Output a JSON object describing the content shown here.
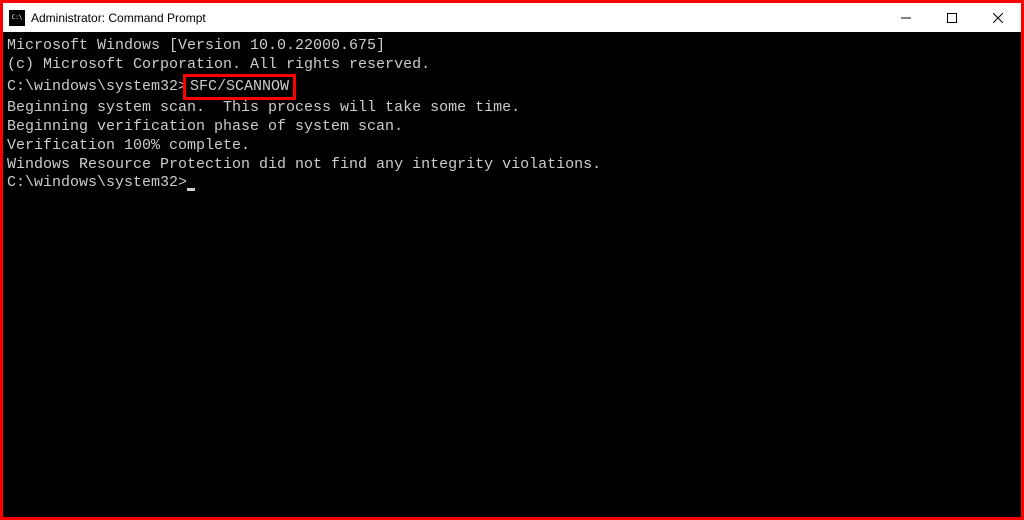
{
  "window": {
    "title": "Administrator: Command Prompt"
  },
  "colors": {
    "border": "#ff0000",
    "terminal_bg": "#000000",
    "terminal_fg": "#cccccc"
  },
  "terminal": {
    "lines": {
      "l0": "Microsoft Windows [Version 10.0.22000.675]",
      "l1": "(c) Microsoft Corporation. All rights reserved.",
      "l2": "",
      "prompt1_prefix": "C:\\windows\\system32>",
      "prompt1_cmd": "SFC/SCANNOW",
      "l4": "",
      "l5": "Beginning system scan.  This process will take some time.",
      "l6": "",
      "l7": "Beginning verification phase of system scan.",
      "l8": "Verification 100% complete.",
      "l9": "",
      "l10": "Windows Resource Protection did not find any integrity violations.",
      "l11": "",
      "prompt2": "C:\\windows\\system32>"
    }
  }
}
